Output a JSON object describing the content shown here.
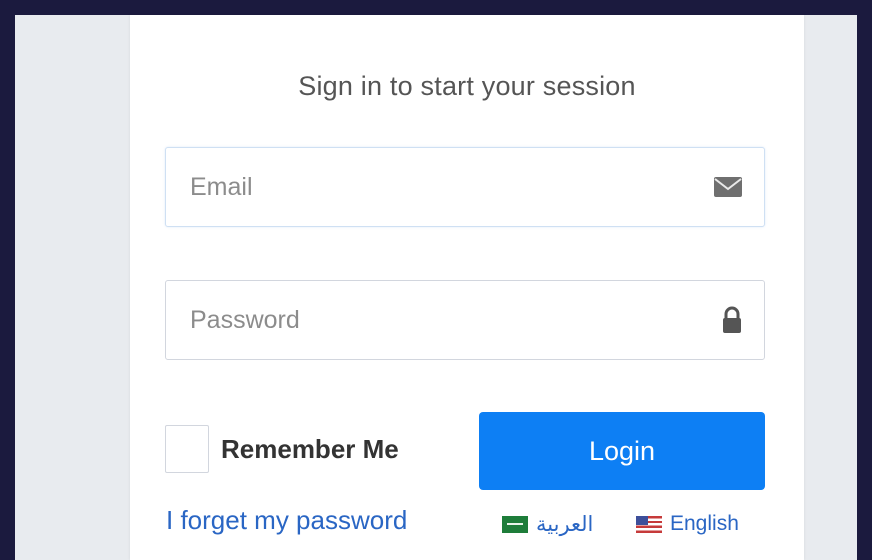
{
  "login": {
    "message": "Sign in to start your session",
    "email": {
      "placeholder": "Email",
      "value": "",
      "icon": "envelope-icon"
    },
    "password": {
      "placeholder": "Password",
      "value": "",
      "icon": "lock-icon"
    },
    "remember_label": "Remember Me",
    "remember_checked": false,
    "login_label": "Login",
    "forgot_label": "I forget my password"
  },
  "languages": [
    {
      "label": "العربية",
      "flag": "saudi-flag-icon"
    },
    {
      "label": "English",
      "flag": "us-flag-icon"
    }
  ],
  "colors": {
    "outer_background": "#1b1a3e",
    "page_background": "#e8ebef",
    "primary_button": "#0d7ff4",
    "link": "#2a66c4"
  }
}
